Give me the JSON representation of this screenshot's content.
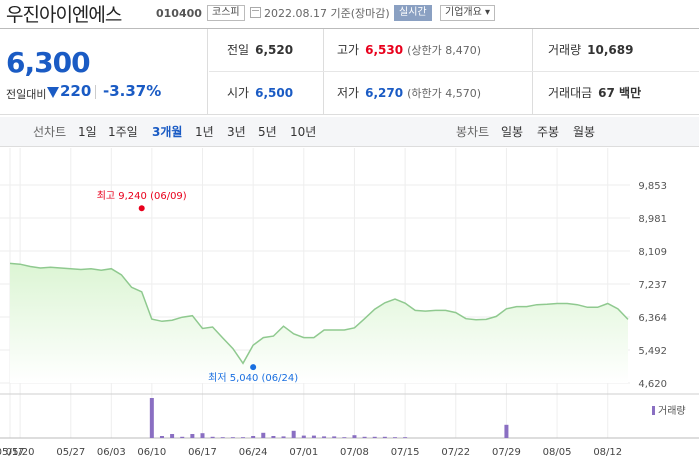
{
  "header": {
    "stock_name": "우진아이엔에스",
    "stock_code": "010400",
    "market": "코스피",
    "date_text": "2022.08.17  기준(장마감)",
    "realtime_label": "실시간",
    "overview_label": "기업개요 ▾"
  },
  "price": {
    "current": "6,300",
    "diff_label": "전일대비",
    "diff_value": "220",
    "diff_rate": "-3.37%"
  },
  "stats": {
    "prev_close": {
      "label": "전일",
      "value": "6,520"
    },
    "high": {
      "label": "고가",
      "value": "6,530",
      "sub": "(상한가 8,470)"
    },
    "volume": {
      "label": "거래량",
      "value": "10,689"
    },
    "open": {
      "label": "시가",
      "value": "6,500"
    },
    "low": {
      "label": "저가",
      "value": "6,270",
      "sub": "(하한가 4,570)"
    },
    "amount": {
      "label": "거래대금",
      "value": "67 백만"
    }
  },
  "tabs": {
    "line_label": "선차트",
    "periods": [
      "1일",
      "1주일",
      "3개월",
      "1년",
      "3년",
      "5년",
      "10년"
    ],
    "active_period": "3개월",
    "candle_label": "봉차트",
    "candles": [
      "일봉",
      "주봉",
      "월봉"
    ]
  },
  "chart_data": {
    "type": "area",
    "x": [
      "05/17",
      "05/20",
      "05/23",
      "05/24",
      "05/25",
      "05/26",
      "05/27",
      "05/30",
      "05/31",
      "06/02",
      "06/03",
      "06/07",
      "06/08",
      "06/09",
      "06/10",
      "06/13",
      "06/14",
      "06/15",
      "06/16",
      "06/17",
      "06/20",
      "06/21",
      "06/22",
      "06/23",
      "06/24",
      "06/27",
      "06/28",
      "06/29",
      "06/30",
      "07/01",
      "07/04",
      "07/05",
      "07/06",
      "07/07",
      "07/08",
      "07/11",
      "07/12",
      "07/13",
      "07/14",
      "07/15",
      "07/18",
      "07/19",
      "07/20",
      "07/21",
      "07/22",
      "07/25",
      "07/26",
      "07/27",
      "07/28",
      "07/29",
      "08/01",
      "08/02",
      "08/03",
      "08/04",
      "08/05",
      "08/08",
      "08/09",
      "08/10",
      "08/11",
      "08/12",
      "08/16",
      "08/17"
    ],
    "series": [
      {
        "values": [
          7780,
          7760,
          7700,
          7660,
          7680,
          7660,
          7640,
          7620,
          7640,
          7600,
          7640,
          7480,
          7150,
          7030,
          6310,
          6250,
          6280,
          6360,
          6400,
          6060,
          6100,
          5810,
          5530,
          5140,
          5620,
          5820,
          5860,
          6120,
          5920,
          5820,
          5820,
          6020,
          6020,
          6020,
          6080,
          6320,
          6570,
          6740,
          6840,
          6730,
          6540,
          6520,
          6540,
          6540,
          6480,
          6320,
          6290,
          6300,
          6380,
          6580,
          6640,
          6640,
          6690,
          6700,
          6720,
          6720,
          6690,
          6620,
          6620,
          6720,
          6580,
          6300
        ]
      }
    ],
    "volume": [
      0,
      0,
      0,
      0,
      0,
      0,
      0,
      0,
      0,
      0,
      0,
      0,
      0,
      0,
      1.0,
      0.05,
      0.1,
      0.03,
      0.1,
      0.12,
      0.03,
      0.02,
      0.02,
      0.02,
      0.05,
      0.13,
      0.05,
      0.04,
      0.18,
      0.06,
      0.06,
      0.04,
      0.04,
      0.02,
      0.07,
      0.03,
      0.03,
      0.03,
      0.02,
      0.02,
      0,
      0,
      0,
      0,
      0,
      0,
      0,
      0,
      0,
      0.33,
      0,
      0,
      0,
      0,
      0,
      0,
      0,
      0,
      0,
      0,
      0,
      0
    ],
    "yticks": [
      "9,853",
      "8,981",
      "8,109",
      "7,237",
      "6,364",
      "5,492",
      "4,620"
    ],
    "ylim": [
      4620,
      9853
    ],
    "xticks": [
      "05/17",
      "05/20",
      "05/27",
      "06/03",
      "06/10",
      "06/17",
      "06/24",
      "07/01",
      "07/08",
      "07/15",
      "07/22",
      "07/29",
      "08/05",
      "08/12"
    ],
    "max_label": "최고 9,240 (06/09)",
    "max_value": 9240,
    "min_label": "최저 5,040 (06/24)",
    "min_value": 5040,
    "volume_label": "거래량",
    "colors": {
      "line": "#8fc98f",
      "fill": "#dcf5d4",
      "volume": "#8a6fc2",
      "max": "#e8001c",
      "min": "#1a6fe0"
    }
  }
}
